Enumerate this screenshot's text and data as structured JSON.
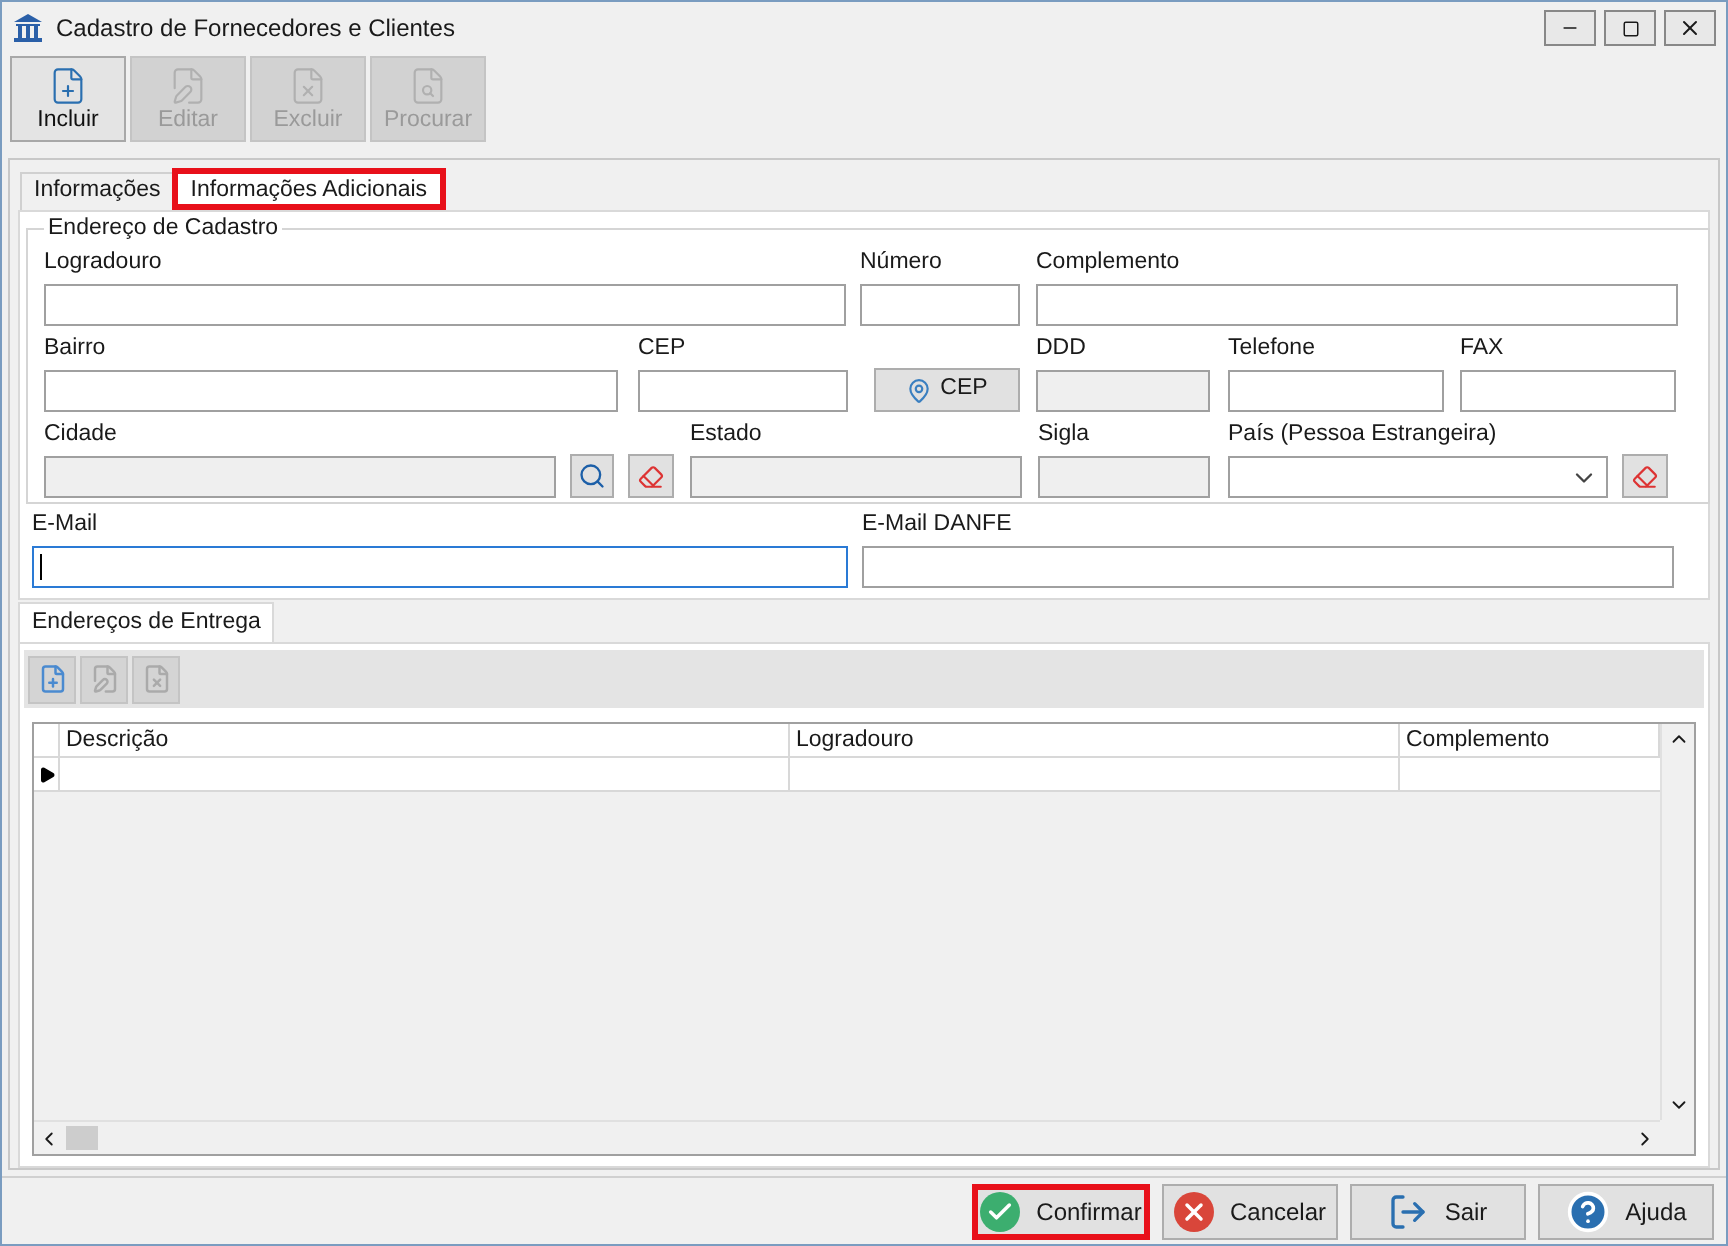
{
  "window": {
    "title": "Cadastro de Fornecedores e Clientes"
  },
  "toolbar": [
    {
      "label": "Incluir",
      "kind": "new",
      "disabled": false
    },
    {
      "label": "Editar",
      "kind": "edit",
      "disabled": true
    },
    {
      "label": "Excluir",
      "kind": "delete",
      "disabled": true
    },
    {
      "label": "Procurar",
      "kind": "find",
      "disabled": true
    }
  ],
  "tabs": [
    {
      "label": "Informações",
      "selected": false,
      "highlighted": false
    },
    {
      "label": "Informações Adicionais",
      "selected": true,
      "highlighted": true
    }
  ],
  "address_group": {
    "title": "Endereço de Cadastro",
    "fields": [
      {
        "kind": "text",
        "label": "Logradouro"
      },
      {
        "kind": "text",
        "label": "Número"
      },
      {
        "kind": "text",
        "label": "Complemento"
      },
      {
        "kind": "text",
        "label": "Bairro"
      },
      {
        "kind": "text",
        "label": "CEP"
      },
      {
        "kind": "cep_button",
        "text": "CEP"
      },
      {
        "kind": "readonly",
        "label": "DDD"
      },
      {
        "kind": "text",
        "label": "Telefone"
      },
      {
        "kind": "text",
        "label": "FAX"
      },
      {
        "kind": "readonly",
        "label": "Cidade"
      },
      {
        "kind": "search"
      },
      {
        "kind": "clear"
      },
      {
        "kind": "readonly",
        "label": "Estado"
      },
      {
        "kind": "readonly",
        "label": "Sigla"
      },
      {
        "kind": "select",
        "label": "País (Pessoa Estrangeira)"
      },
      {
        "kind": "clear"
      }
    ]
  },
  "email_fields": [
    {
      "label": "E-Mail",
      "focused": true
    },
    {
      "label": "E-Mail DANFE",
      "focused": false
    }
  ],
  "delivery": {
    "tab": {
      "label": "Endereços de Entrega",
      "selected": true
    },
    "table": {
      "columns": [
        "Descrição",
        "Logradouro",
        "Complemento"
      ]
    }
  },
  "footer_buttons": [
    {
      "label": "Confirmar",
      "kind": "confirm",
      "highlighted": true
    },
    {
      "label": "Cancelar",
      "kind": "cancel",
      "highlighted": false
    },
    {
      "label": "Sair",
      "kind": "exit",
      "highlighted": false
    },
    {
      "label": "Ajuda",
      "kind": "help",
      "highlighted": false
    }
  ]
}
